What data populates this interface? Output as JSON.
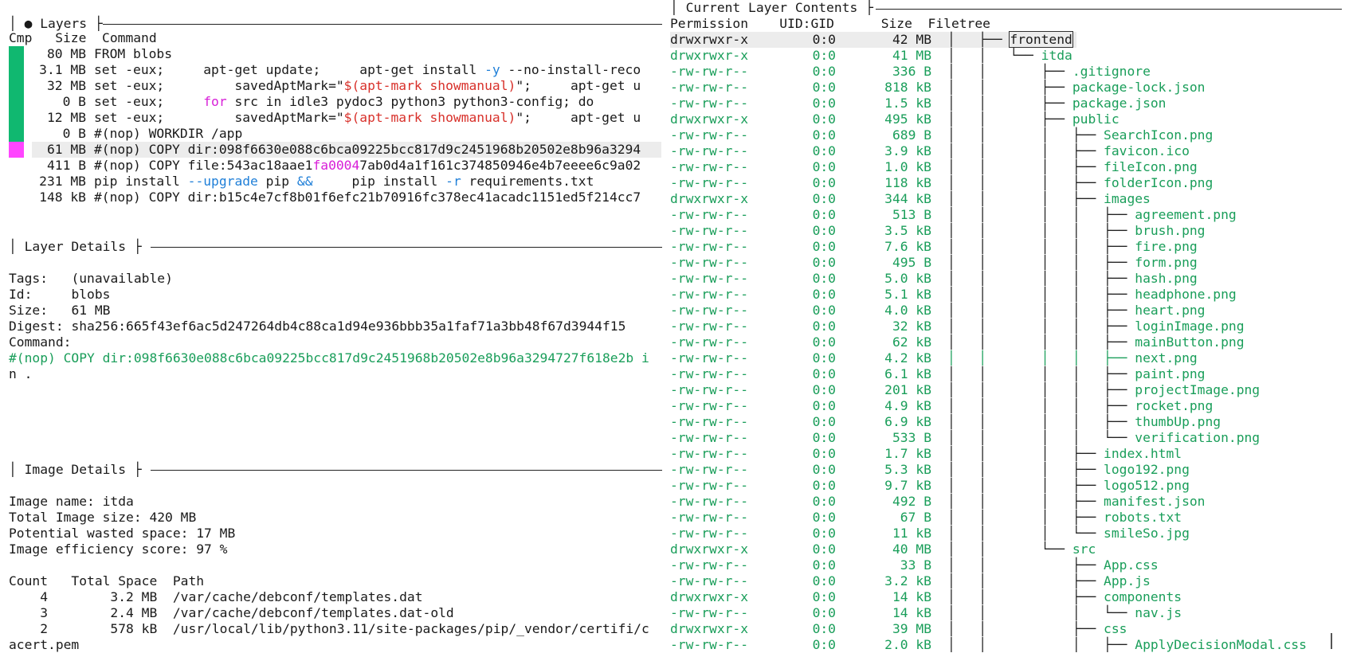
{
  "layers_panel": {
    "title": "● Layers",
    "col_cmp": "Cmp",
    "col_size": "Size",
    "col_command": "Command",
    "rows": [
      {
        "size": "80 MB",
        "cmd": "FROM blobs",
        "cmp": "g"
      },
      {
        "size": "3.1 MB",
        "cmd": "set -eux;     apt-get update;     apt-get install -y --no-install-reco",
        "cmp": "g"
      },
      {
        "size": "32 MB",
        "cmd": "set -eux;         savedAptMark=\"$(apt-mark showmanual)\";     apt-get u",
        "cmp": "g"
      },
      {
        "size": "0 B",
        "cmd": "set -eux;     for src in idle3 pydoc3 python3 python3-config; do",
        "cmp": "g"
      },
      {
        "size": "12 MB",
        "cmd": "set -eux;         savedAptMark=\"$(apt-mark showmanual)\";     apt-get u",
        "cmp": "g"
      },
      {
        "size": "0 B",
        "cmd": "#(nop) WORKDIR /app",
        "cmp": "g"
      },
      {
        "size": "61 MB",
        "cmd": "#(nop) COPY dir:098f6630e088c6bca09225bcc817d9c2451968b20502e8b96a3294",
        "cmp": "m"
      },
      {
        "size": "411 B",
        "cmd": "#(nop) COPY file:543ac18aae1fa00047ab0d4a1f161c374850946e4b7eeee6c9a02",
        "cmp": ""
      },
      {
        "size": "231 MB",
        "cmd": "pip install --upgrade pip &&     pip install -r requirements.txt",
        "cmp": ""
      },
      {
        "size": "148 kB",
        "cmd": "#(nop) COPY dir:b15c4e7cf8b01f6efc21b70916fc378ec41acadc1151ed5f214cc7",
        "cmp": ""
      }
    ]
  },
  "layer_details": {
    "title": "Layer Details",
    "tags_label": "Tags:",
    "tags_value": "(unavailable)",
    "id_label": "Id:",
    "id_value": "blobs",
    "size_label": "Size:",
    "size_value": "61 MB",
    "digest_label": "Digest:",
    "digest_value": "sha256:665f43ef6ac5d247264db4c88ca1d94e936bbb35a1faf71a3bb48f67d3944f15",
    "command_label": "Command:",
    "command_line1": "#(nop) COPY dir:098f6630e088c6bca09225bcc817d9c2451968b20502e8b96a3294727f618e2b i",
    "command_line2": "n ."
  },
  "image_details": {
    "title": "Image Details",
    "name_line": "Image name: itda",
    "total_line": "Total Image size: 420 MB",
    "wasted_line": "Potential wasted space: 17 MB",
    "efficiency_line": "Image efficiency score: 97 %",
    "table_header": "Count   Total Space  Path",
    "rows": [
      "    4        3.2 MB  /var/cache/debconf/templates.dat",
      "    3        2.4 MB  /var/cache/debconf/templates.dat-old",
      "    2        578 kB  /usr/local/lib/python3.11/site-packages/pip/_vendor/certifi/c"
    ],
    "wrap_line": "acert.pem"
  },
  "contents_panel": {
    "title": "Current Layer Contents",
    "col_permission": "Permission",
    "col_uidgid": "UID:GID",
    "col_size": "Size",
    "col_filetree": "Filetree",
    "rows": [
      {
        "perm": "drwxrwxr-x",
        "uid": "0:0",
        "size": "42 MB",
        "tree": "│   ├── ",
        "name": "frontend",
        "sel": true
      },
      {
        "perm": "drwxrwxr-x",
        "uid": "0:0",
        "size": "41 MB",
        "tree": "│   │   └── ",
        "name": "itda"
      },
      {
        "perm": "-rw-rw-r--",
        "uid": "0:0",
        "size": "336 B",
        "tree": "│   │       ├── ",
        "name": ".gitignore"
      },
      {
        "perm": "-rw-rw-r--",
        "uid": "0:0",
        "size": "818 kB",
        "tree": "│   │       ├── ",
        "name": "package-lock.json"
      },
      {
        "perm": "-rw-rw-r--",
        "uid": "0:0",
        "size": "1.5 kB",
        "tree": "│   │       ├── ",
        "name": "package.json"
      },
      {
        "perm": "drwxrwxr-x",
        "uid": "0:0",
        "size": "495 kB",
        "tree": "│   │       ├── ",
        "name": "public"
      },
      {
        "perm": "-rw-rw-r--",
        "uid": "0:0",
        "size": "689 B",
        "tree": "│   │       │   ├── ",
        "name": "SearchIcon.png"
      },
      {
        "perm": "-rw-rw-r--",
        "uid": "0:0",
        "size": "3.9 kB",
        "tree": "│   │       │   ├── ",
        "name": "favicon.ico"
      },
      {
        "perm": "-rw-rw-r--",
        "uid": "0:0",
        "size": "1.0 kB",
        "tree": "│   │       │   ├── ",
        "name": "fileIcon.png"
      },
      {
        "perm": "-rw-rw-r--",
        "uid": "0:0",
        "size": "118 kB",
        "tree": "│   │       │   ├── ",
        "name": "folderIcon.png"
      },
      {
        "perm": "drwxrwxr-x",
        "uid": "0:0",
        "size": "344 kB",
        "tree": "│   │       │   ├── ",
        "name": "images"
      },
      {
        "perm": "-rw-rw-r--",
        "uid": "0:0",
        "size": "513 B",
        "tree": "│   │       │   │   ├── ",
        "name": "agreement.png"
      },
      {
        "perm": "-rw-rw-r--",
        "uid": "0:0",
        "size": "3.5 kB",
        "tree": "│   │       │   │   ├── ",
        "name": "brush.png"
      },
      {
        "perm": "-rw-rw-r--",
        "uid": "0:0",
        "size": "7.6 kB",
        "tree": "│   │       │   │   ├── ",
        "name": "fire.png"
      },
      {
        "perm": "-rw-rw-r--",
        "uid": "0:0",
        "size": "495 B",
        "tree": "│   │       │   │   ├── ",
        "name": "form.png"
      },
      {
        "perm": "-rw-rw-r--",
        "uid": "0:0",
        "size": "5.0 kB",
        "tree": "│   │       │   │   ├── ",
        "name": "hash.png"
      },
      {
        "perm": "-rw-rw-r--",
        "uid": "0:0",
        "size": "5.1 kB",
        "tree": "│   │       │   │   ├── ",
        "name": "headphone.png"
      },
      {
        "perm": "-rw-rw-r--",
        "uid": "0:0",
        "size": "4.0 kB",
        "tree": "│   │       │   │   ├── ",
        "name": "heart.png"
      },
      {
        "perm": "-rw-rw-r--",
        "uid": "0:0",
        "size": "32 kB",
        "tree": "│   │       │   │   ├── ",
        "name": "loginImage.png"
      },
      {
        "perm": "-rw-rw-r--",
        "uid": "0:0",
        "size": "62 kB",
        "tree": "│   │       │   │   ├── ",
        "name": "mainButton.png"
      },
      {
        "perm": "-rw-rw-r--",
        "uid": "0:0",
        "size": "4.2 kB",
        "tree": "│   │       │   │   ├── ",
        "name": "next.png",
        "greentree": true
      },
      {
        "perm": "-rw-rw-r--",
        "uid": "0:0",
        "size": "6.1 kB",
        "tree": "│   │       │   │   ├── ",
        "name": "paint.png"
      },
      {
        "perm": "-rw-rw-r--",
        "uid": "0:0",
        "size": "201 kB",
        "tree": "│   │       │   │   ├── ",
        "name": "projectImage.png"
      },
      {
        "perm": "-rw-rw-r--",
        "uid": "0:0",
        "size": "4.9 kB",
        "tree": "│   │       │   │   ├── ",
        "name": "rocket.png"
      },
      {
        "perm": "-rw-rw-r--",
        "uid": "0:0",
        "size": "6.9 kB",
        "tree": "│   │       │   │   ├── ",
        "name": "thumbUp.png"
      },
      {
        "perm": "-rw-rw-r--",
        "uid": "0:0",
        "size": "533 B",
        "tree": "│   │       │   │   └── ",
        "name": "verification.png"
      },
      {
        "perm": "-rw-rw-r--",
        "uid": "0:0",
        "size": "1.7 kB",
        "tree": "│   │       │   ├── ",
        "name": "index.html"
      },
      {
        "perm": "-rw-rw-r--",
        "uid": "0:0",
        "size": "5.3 kB",
        "tree": "│   │       │   ├── ",
        "name": "logo192.png"
      },
      {
        "perm": "-rw-rw-r--",
        "uid": "0:0",
        "size": "9.7 kB",
        "tree": "│   │       │   ├── ",
        "name": "logo512.png"
      },
      {
        "perm": "-rw-rw-r--",
        "uid": "0:0",
        "size": "492 B",
        "tree": "│   │       │   ├── ",
        "name": "manifest.json"
      },
      {
        "perm": "-rw-rw-r--",
        "uid": "0:0",
        "size": "67 B",
        "tree": "│   │       │   ├── ",
        "name": "robots.txt"
      },
      {
        "perm": "-rw-rw-r--",
        "uid": "0:0",
        "size": "11 kB",
        "tree": "│   │       │   └── ",
        "name": "smileSo.jpg"
      },
      {
        "perm": "drwxrwxr-x",
        "uid": "0:0",
        "size": "40 MB",
        "tree": "│   │       └── ",
        "name": "src"
      },
      {
        "perm": "-rw-rw-r--",
        "uid": "0:0",
        "size": "33 B",
        "tree": "│   │           ├── ",
        "name": "App.css"
      },
      {
        "perm": "-rw-rw-r--",
        "uid": "0:0",
        "size": "3.2 kB",
        "tree": "│   │           ├── ",
        "name": "App.js"
      },
      {
        "perm": "drwxrwxr-x",
        "uid": "0:0",
        "size": "14 kB",
        "tree": "│   │           ├── ",
        "name": "components"
      },
      {
        "perm": "-rw-rw-r--",
        "uid": "0:0",
        "size": "14 kB",
        "tree": "│   │           │   └── ",
        "name": "nav.js"
      },
      {
        "perm": "drwxrwxr-x",
        "uid": "0:0",
        "size": "39 MB",
        "tree": "│   │           ├── ",
        "name": "css"
      },
      {
        "perm": "-rw-rw-r--",
        "uid": "0:0",
        "size": "2.0 kB",
        "tree": "│   │           │   ├── ",
        "name": "ApplyDecisionModal.css"
      }
    ]
  },
  "colors": {
    "green": "#1a9e5a",
    "cmp_green": "#10b870",
    "cmp_magenta": "#ff45ff",
    "selected_bg": "#ececec"
  }
}
